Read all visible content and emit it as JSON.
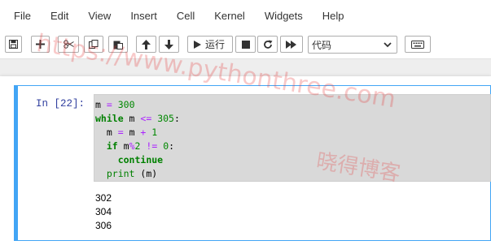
{
  "menubar": {
    "items": [
      "File",
      "Edit",
      "View",
      "Insert",
      "Cell",
      "Kernel",
      "Widgets",
      "Help"
    ]
  },
  "toolbar": {
    "run_label": "运行",
    "cell_type": "代码"
  },
  "cell": {
    "prompt": "In  [22]:",
    "code_lines": [
      "m = 300",
      "while m <= 305:",
      "  m = m + 1",
      "  if m%2 != 0:",
      "    continue",
      "  print (m)"
    ],
    "output_lines": [
      "302",
      "304",
      "306"
    ]
  },
  "watermark": {
    "url": "https://www.pythonthree.com",
    "text": "晓得博客"
  },
  "colors": {
    "selected_cell_border": "#42a5f5",
    "prompt": "#303f9f",
    "keyword": "#008000",
    "operator": "#aa22ff"
  }
}
